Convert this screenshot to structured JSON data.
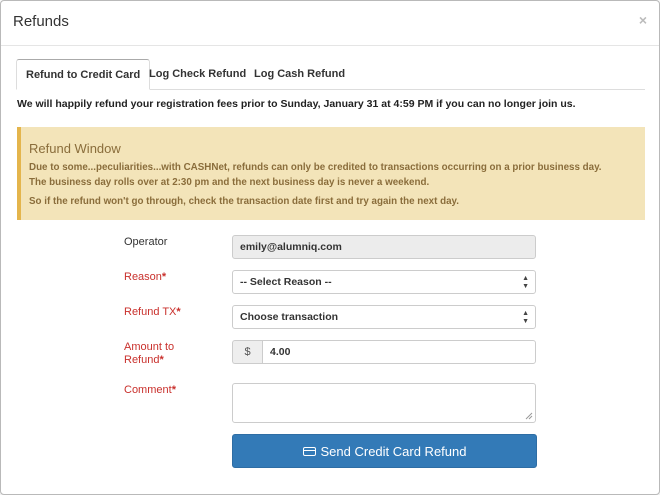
{
  "modal": {
    "title": "Refunds",
    "close_label": "×"
  },
  "tabs": [
    {
      "label": "Refund to Credit Card",
      "active": true
    },
    {
      "label": "Log Check Refund",
      "active": false
    },
    {
      "label": "Log Cash Refund",
      "active": false
    }
  ],
  "intro_text": "We will happily refund your registration fees prior to Sunday, January 31 at 4:59 PM if you can no longer join us.",
  "alert": {
    "title": "Refund Window",
    "line1": "Due to some...peculiarities...with CASHNet, refunds can only be credited to transactions occurring on a prior business day.",
    "line2": "The business day rolls over at 2:30 pm and the next business day is never a weekend.",
    "line3": "So if the refund won't go through, check the transaction date first and try again the next day."
  },
  "form": {
    "operator": {
      "label": "Operator",
      "value": "emily@alumniq.com"
    },
    "reason": {
      "label": "Reason",
      "required_mark": "*",
      "selected": "-- Select Reason --"
    },
    "refund_tx": {
      "label": "Refund TX",
      "required_mark": "*",
      "selected": "Choose transaction"
    },
    "amount": {
      "label_line1": "Amount to",
      "label_line2": "Refund",
      "required_mark": "*",
      "currency": "$",
      "value": "4.00"
    },
    "comment": {
      "label": "Comment",
      "required_mark": "*",
      "value": ""
    },
    "submit_label": "Send Credit Card Refund"
  },
  "colors": {
    "primary_button": "#337ab7",
    "required_label": "#c9302c",
    "alert_background": "#f3e4b9",
    "alert_text": "#8a6d3b"
  },
  "icons": {
    "submit_icon": "credit-card-icon",
    "select_icon": "select-arrows-icon"
  }
}
